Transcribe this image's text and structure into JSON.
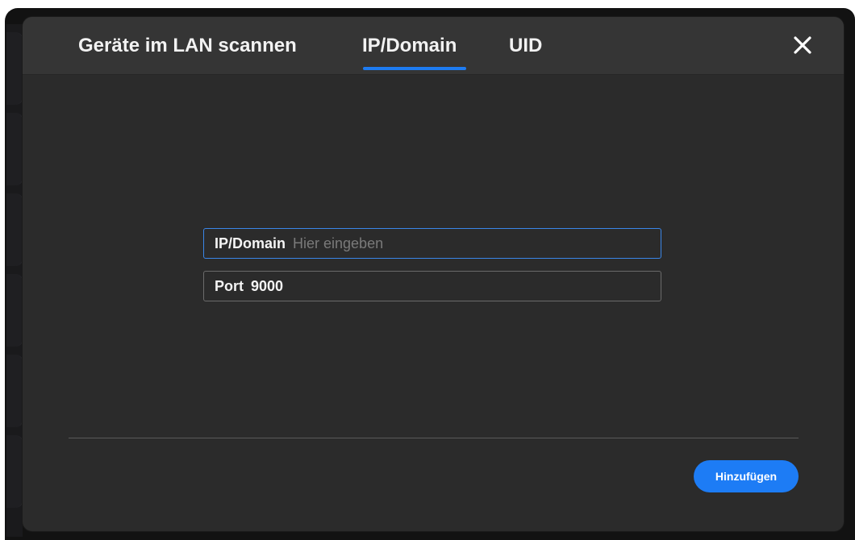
{
  "dialog": {
    "tabs": [
      {
        "label": "Geräte im LAN scannen",
        "active": false
      },
      {
        "label": "IP/Domain",
        "active": true
      },
      {
        "label": "UID",
        "active": false
      }
    ],
    "close_icon": "close-icon"
  },
  "form": {
    "ip_label": "IP/Domain",
    "ip_value": "",
    "ip_placeholder": "Hier eingeben",
    "port_label": "Port",
    "port_value": "9000"
  },
  "footer": {
    "add_label": "Hinzufügen"
  },
  "colors": {
    "accent": "#1e7cf2",
    "dialog_bg": "#2b2b2b",
    "header_bg": "#353535"
  }
}
